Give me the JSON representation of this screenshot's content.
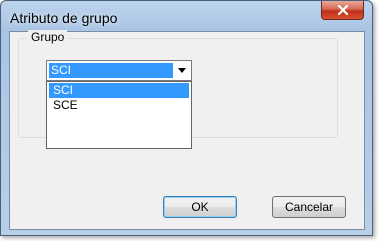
{
  "window": {
    "title": "Atributo de grupo",
    "close_symbol": "x"
  },
  "group": {
    "label": "Grupo",
    "selected_value": "SCI",
    "options": [
      "SCI",
      "SCE"
    ],
    "highlighted_index": 0
  },
  "buttons": {
    "ok_label": "OK",
    "cancel_label": "Cancelar"
  },
  "colors": {
    "selection": "#3399ff",
    "title_bar": "#a9c4e4",
    "close_button": "#c0301a"
  }
}
